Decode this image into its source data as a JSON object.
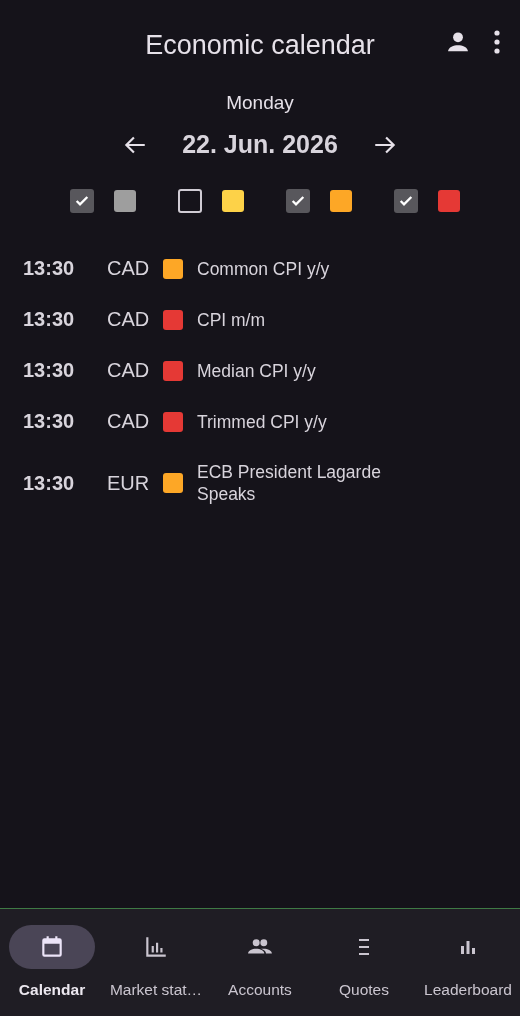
{
  "header": {
    "title": "Economic calendar"
  },
  "day": "Monday",
  "date": "22. Jun. 2026",
  "filters": [
    {
      "checked": true,
      "color": "#9e9e9e"
    },
    {
      "checked": false,
      "color": "#fdd248"
    },
    {
      "checked": true,
      "color": "#fda726"
    },
    {
      "checked": true,
      "color": "#e53935"
    }
  ],
  "events": [
    {
      "time": "13:30",
      "currency": "CAD",
      "color": "#fda726",
      "title": "Common CPI y/y"
    },
    {
      "time": "13:30",
      "currency": "CAD",
      "color": "#e53935",
      "title": "CPI m/m"
    },
    {
      "time": "13:30",
      "currency": "CAD",
      "color": "#e53935",
      "title": "Median CPI y/y"
    },
    {
      "time": "13:30",
      "currency": "CAD",
      "color": "#e53935",
      "title": "Trimmed CPI y/y"
    },
    {
      "time": "13:30",
      "currency": "EUR",
      "color": "#fda726",
      "title": "ECB President Lagarde Speaks"
    }
  ],
  "nav": [
    {
      "kind": "calendar",
      "label": "Calendar",
      "selected": true
    },
    {
      "kind": "stats",
      "label": "Market stat…",
      "selected": false
    },
    {
      "kind": "accounts",
      "label": "Accounts",
      "selected": false
    },
    {
      "kind": "quotes",
      "label": "Quotes",
      "selected": false
    },
    {
      "kind": "leaderboard",
      "label": "Leaderboard",
      "selected": false
    }
  ]
}
